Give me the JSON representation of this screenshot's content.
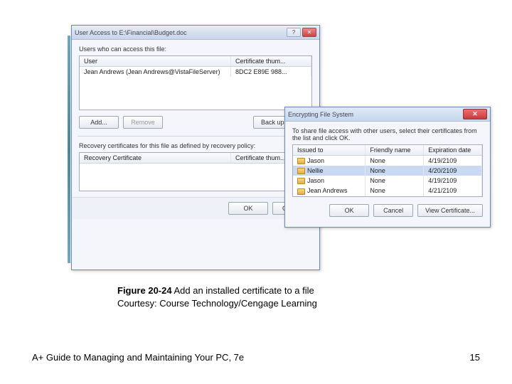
{
  "main_dialog": {
    "title": "User Access to E:\\Financial\\Budget.doc",
    "users_label": "Users who can access this file:",
    "col_user": "User",
    "col_cert": "Certificate thum...",
    "user_row_name": "Jean Andrews (Jean Andrews@VistaFileServer)",
    "user_row_cert": "8DC2 E89E 988...",
    "btn_add": "Add...",
    "btn_remove": "Remove",
    "btn_backup": "Back up keys...",
    "recovery_label": "Recovery certificates for this file as defined by recovery policy:",
    "col_recovery": "Recovery Certificate",
    "col_recovery_cert": "Certificate thum...",
    "btn_ok": "OK",
    "btn_cancel": "Cancel"
  },
  "efs_dialog": {
    "title": "Encrypting File System",
    "instruction": "To share file access with other users, select their certificates from the list and click OK.",
    "col_issued": "Issued to",
    "col_friendly": "Friendly name",
    "col_expire": "Expiration date",
    "rows": [
      {
        "issued": "Jason",
        "friendly": "None",
        "expire": "4/19/2109"
      },
      {
        "issued": "Nellie",
        "friendly": "None",
        "expire": "4/20/2109"
      },
      {
        "issued": "Jason",
        "friendly": "None",
        "expire": "4/19/2109"
      },
      {
        "issued": "Jean Andrews",
        "friendly": "None",
        "expire": "4/21/2109"
      }
    ],
    "btn_ok": "OK",
    "btn_cancel": "Cancel",
    "btn_view": "View Certificate..."
  },
  "caption": {
    "fig_label": "Figure 20-24",
    "fig_text": " Add an installed certificate to a file",
    "courtesy": "Courtesy: Course Technology/Cengage Learning"
  },
  "footer": {
    "left": "A+ Guide to Managing and Maintaining Your PC, 7e",
    "right": "15"
  }
}
